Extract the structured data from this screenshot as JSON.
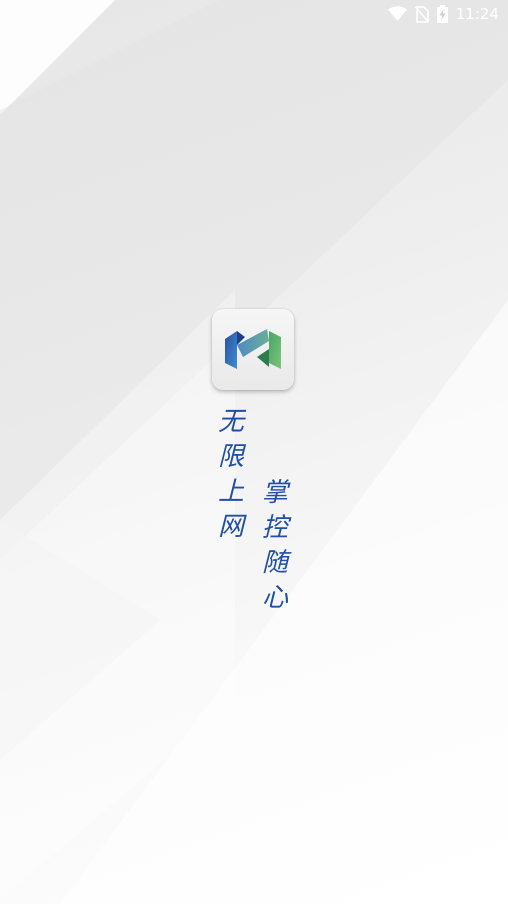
{
  "status_bar": {
    "time": "11:24",
    "icons": [
      "wifi-icon",
      "no-sim-icon",
      "battery-charging-icon"
    ]
  },
  "splash": {
    "logo": "app-logo-icon",
    "slogan_line1": [
      "无",
      "限",
      "上",
      "网"
    ],
    "slogan_line2": [
      "掌",
      "控",
      "随",
      "心"
    ],
    "slogan_color": "#1f4fa6"
  }
}
